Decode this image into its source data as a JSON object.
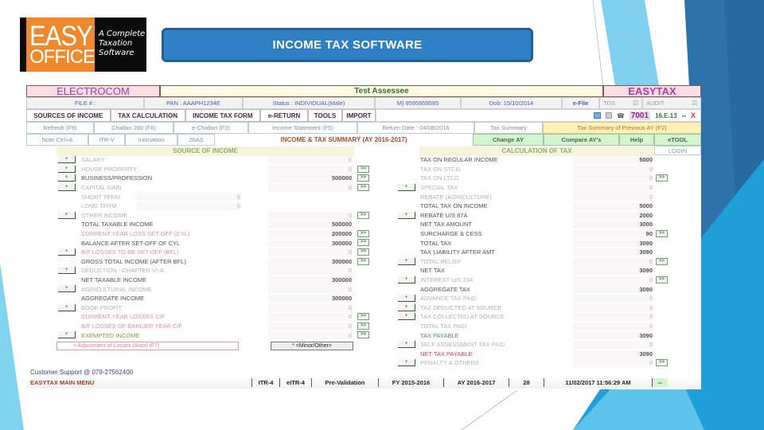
{
  "logo": {
    "line1": "EASY",
    "line2": "OFFICE",
    "tagline1": "A Complete",
    "tagline2": "Taxation",
    "tagline3": "Software"
  },
  "banner": {
    "title": "INCOME TAX SOFTWARE"
  },
  "app": {
    "company": "ELECTROCOM",
    "assessee": "Test Assessee",
    "product": "EASYTAX",
    "info": {
      "file": "FILE # :",
      "pan": "PAN : AAAPH1234E",
      "status": "Status : INDIVIDUAL(Male)",
      "mobile": "M) 9595959595",
      "dob": "Dob: 15/10/2014",
      "efile": "e-File",
      "tds": "TDS",
      "audit": "AUDIT",
      "checkbox_glyph": "☑"
    },
    "menu": [
      {
        "label": "SOURCES OF INCOME"
      },
      {
        "label": "TAX CALCULATION"
      },
      {
        "label": "INCOME TAX FORM"
      },
      {
        "label": "e-RETURN"
      },
      {
        "label": "TOOLS"
      },
      {
        "label": "IMPORT"
      }
    ],
    "toolbar_right": {
      "code": "7001",
      "version": "16.E.13",
      "minimize": "--",
      "close": "X",
      "phone_glyph": "☎"
    },
    "actions_row1": [
      {
        "label": "Refresh (F9)"
      },
      {
        "label": "Challan 280 (F6)"
      },
      {
        "label": "e-Challan (F3)"
      },
      {
        "label": "Income Statement (F5)"
      },
      {
        "label": "Return Date : 04/08/2016"
      },
      {
        "label": "Tax Summary"
      },
      {
        "label": "Tax Summary of Previous AY (F2)"
      }
    ],
    "actions_row2": [
      {
        "label": "Note Ctrl+A"
      },
      {
        "label": "ITR-V"
      },
      {
        "label": "Intimation"
      },
      {
        "label": "26AS"
      },
      {
        "label": "INCOME & TAX SUMMARY (AY 2016-2017)"
      },
      {
        "label": "Change AY"
      },
      {
        "label": "Compare AY's"
      },
      {
        "label": "Help"
      },
      {
        "label": "eTOOL"
      }
    ],
    "login": "LOGIN",
    "source_of_income": {
      "heading": "SOURCE OF INCOME",
      "rows": [
        {
          "label": "SALARY",
          "value": "0"
        },
        {
          "label": "HOUSE PROPERTY",
          "value": "0"
        },
        {
          "label": "BUSINESS/PROFESSION",
          "value": "500000"
        },
        {
          "label": "CAPITAL GAIN",
          "value": "0"
        },
        {
          "label": "SHORT TERM",
          "value": "0"
        },
        {
          "label": "LONG TERM",
          "value": "0"
        },
        {
          "label": "OTHER INCOME",
          "value": "0"
        },
        {
          "label": "TOTAL TAXABLE INCOME",
          "value": "500000"
        },
        {
          "label": "CURRENT YEAR LOSS SET-OFF (CYL)",
          "value": "200000"
        },
        {
          "label": "BALANCE AFTER SET-OFF OF CYL",
          "value": "300000"
        },
        {
          "label": "B/F LOSSES TO BE SET-OFF (BFL)",
          "value": "0"
        },
        {
          "label": "GROSS TOTAL INCOME (AFTER BFL)",
          "value": "300000"
        },
        {
          "label": "DEDUCTION - CHAPTER VI-A",
          "value": "0"
        },
        {
          "label": "NET TAXABLE INCOME",
          "value": "300000"
        },
        {
          "label": "AGRICULTURAL INCOME",
          "value": "0"
        },
        {
          "label": "AGGREGATE INCOME",
          "value": "300000"
        },
        {
          "label": "BOOK PROFIT",
          "value": "0"
        },
        {
          "label": "CURRENT YEAR LOSSES C/F",
          "value": "0"
        },
        {
          "label": "B/F LOSSES OF EARLIER YEAR C/F",
          "value": "0"
        },
        {
          "label": "EXEMPTED INCOME",
          "value": "0"
        }
      ],
      "adjustment": "+   Adjustment of Losses (Auto) (F7)",
      "category": "* <Minor/Other>"
    },
    "calculation_of_tax": {
      "heading": "CALCULATION OF TAX",
      "rows": [
        {
          "label": "TAX ON REGULAR INCOME",
          "value": "5000"
        },
        {
          "label": "TAX ON STCG",
          "value": "0"
        },
        {
          "label": "TAX ON LTCG",
          "value": "0"
        },
        {
          "label": "SPECIAL TAX",
          "value": "0"
        },
        {
          "label": "REBATE (AGRICULTURE)",
          "value": "0"
        },
        {
          "label": "TOTAL TAX ON INCOME",
          "value": "5000"
        },
        {
          "label": "REBATE U/S 87A",
          "value": "2000"
        },
        {
          "label": "NET TAX AMOUNT",
          "value": "3000"
        },
        {
          "label": "SURCHARGE & CESS",
          "value": "90"
        },
        {
          "label": "TOTAL TAX",
          "value": "3090"
        },
        {
          "label": "TAX LIABILITY AFTER AMT",
          "value": "3090"
        },
        {
          "label": "TOTAL RELIEF",
          "value": "0"
        },
        {
          "label": "NET TAX",
          "value": "3090"
        },
        {
          "label": "INTEREST U/S 234",
          "value": "0"
        },
        {
          "label": "AGGREGATE TAX",
          "value": "3090"
        },
        {
          "label": "ADVANCE TAX PAID",
          "value": "0"
        },
        {
          "label": "TAX DEDUCTED AT SOURCE",
          "value": "0"
        },
        {
          "label": "TAX COLLECTED AT SOURCE",
          "value": "0"
        },
        {
          "label": "TOTAL TAX PAID",
          "value": "0"
        },
        {
          "label": "TAX PAYABLE",
          "value": "3090"
        },
        {
          "label": "SELF ASSESSMENT TAX PAID",
          "value": "0"
        },
        {
          "label": "NET TAX PAYABLE",
          "value": "3090"
        },
        {
          "label": "PENALTY & OTHERS",
          "value": "0"
        }
      ]
    },
    "plus_label": "+",
    "arrow_label": ">>",
    "support": "Customer Support @ 079-27562400",
    "footer": {
      "menu": "EASYTAX MAIN MENU",
      "itr": "ITR-4",
      "eitr": "eITR-4",
      "prevalidation": "Pre-Validation",
      "fy": "FY 2015-2016",
      "ay": "AY 2016-2017",
      "count": "28",
      "datetime": "11/02/2017 11:56:29 AM",
      "dash": "--"
    }
  }
}
